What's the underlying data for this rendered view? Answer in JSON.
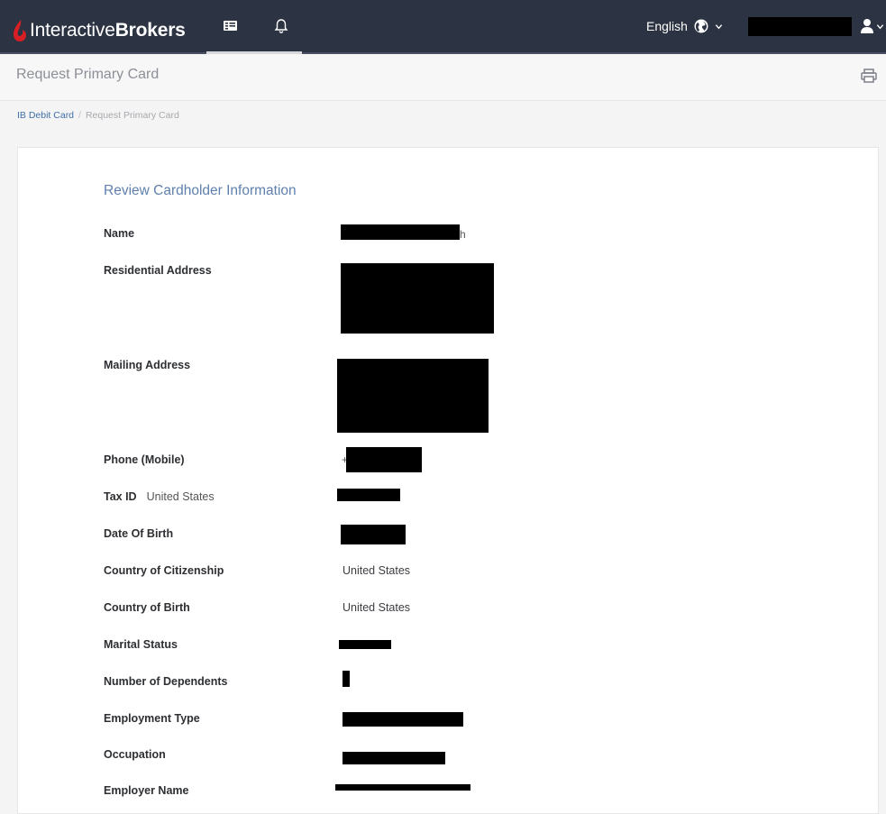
{
  "header": {
    "logo_regular": "Interactive",
    "logo_bold": "Brokers",
    "language": "English"
  },
  "page": {
    "title": "Request Primary Card"
  },
  "breadcrumb": {
    "items": [
      "IB Debit Card",
      "Request Primary Card"
    ],
    "separator": "/"
  },
  "review": {
    "section_title": "Review Cardholder Information",
    "fields": [
      {
        "label": "Name",
        "value": ""
      },
      {
        "label": "Residential Address",
        "value": ""
      },
      {
        "label": "Mailing Address",
        "value": ""
      },
      {
        "label": "Phone (Mobile)",
        "value": ""
      },
      {
        "label": "Tax ID",
        "sub_label": "United States",
        "value": ""
      },
      {
        "label": "Date Of Birth",
        "value": ""
      },
      {
        "label": "Country of Citizenship",
        "value": "United States"
      },
      {
        "label": "Country of Birth",
        "value": "United States"
      },
      {
        "label": "Marital Status",
        "value": ""
      },
      {
        "label": "Number of Dependents",
        "value": ""
      },
      {
        "label": "Employment Type",
        "value": ""
      },
      {
        "label": "Occupation",
        "value": ""
      },
      {
        "label": "Employer Name",
        "value": ""
      }
    ]
  },
  "colors": {
    "navbar": "#2c3342",
    "brand_red": "#d81f26",
    "link": "#3f6fa8",
    "section_title": "#5f80ad"
  },
  "icons": [
    "logo-flame-icon",
    "list-icon",
    "bell-icon",
    "globe-icon",
    "chevron-down-icon",
    "user-icon",
    "print-icon"
  ]
}
